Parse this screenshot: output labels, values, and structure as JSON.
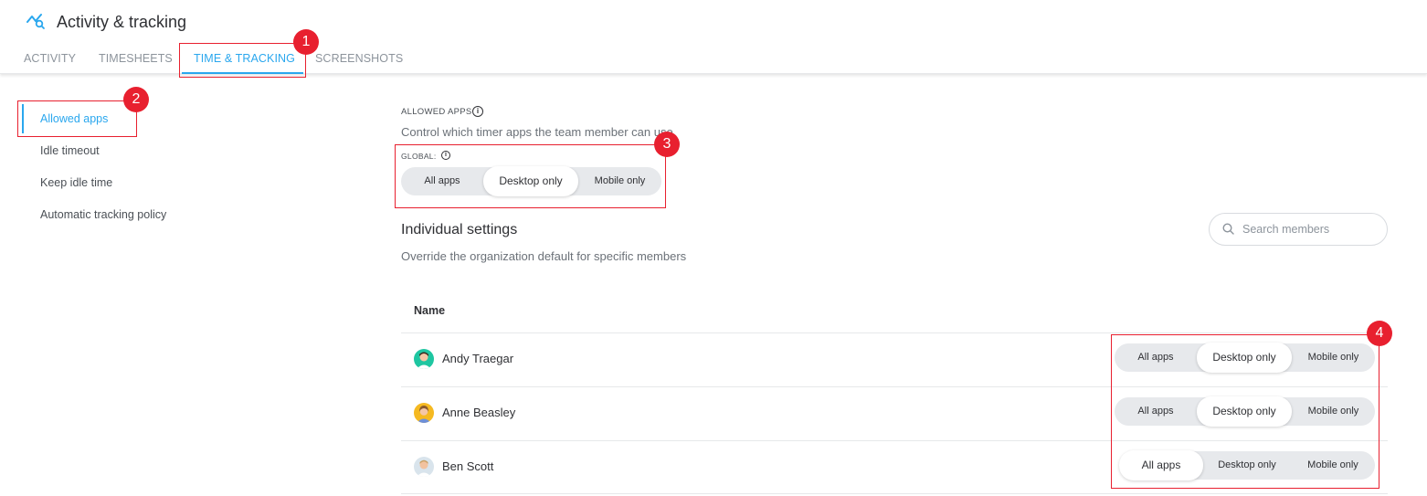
{
  "header": {
    "title": "Activity & tracking",
    "icon": "activity-chart-icon",
    "tabs": [
      {
        "label": "ACTIVITY",
        "active": false
      },
      {
        "label": "TIMESHEETS",
        "active": false
      },
      {
        "label": "TIME & TRACKING",
        "active": true
      },
      {
        "label": "SCREENSHOTS",
        "active": false
      }
    ]
  },
  "sidebar": {
    "items": [
      {
        "label": "Allowed apps",
        "active": true
      },
      {
        "label": "Idle timeout",
        "active": false
      },
      {
        "label": "Keep idle time",
        "active": false
      },
      {
        "label": "Automatic tracking policy",
        "active": false
      }
    ]
  },
  "allowed_apps": {
    "label": "ALLOWED APPS",
    "description": "Control which timer apps the team member can use",
    "global_label": "GLOBAL:",
    "options": [
      "All apps",
      "Desktop only",
      "Mobile only"
    ],
    "global_selected": "Desktop only"
  },
  "individual": {
    "title": "Individual settings",
    "description": "Override the organization default for specific members",
    "search_placeholder": "Search members",
    "column_name": "Name",
    "members": [
      {
        "name": "Andy Traegar",
        "selected": "Desktop only"
      },
      {
        "name": "Anne Beasley",
        "selected": "Desktop only"
      },
      {
        "name": "Ben Scott",
        "selected": "All apps"
      }
    ]
  },
  "annotations": [
    "1",
    "2",
    "3",
    "4"
  ],
  "colors": {
    "accent": "#2aa7ee",
    "annotation": "#e8202f",
    "segment_bg": "#e7e9ec"
  }
}
